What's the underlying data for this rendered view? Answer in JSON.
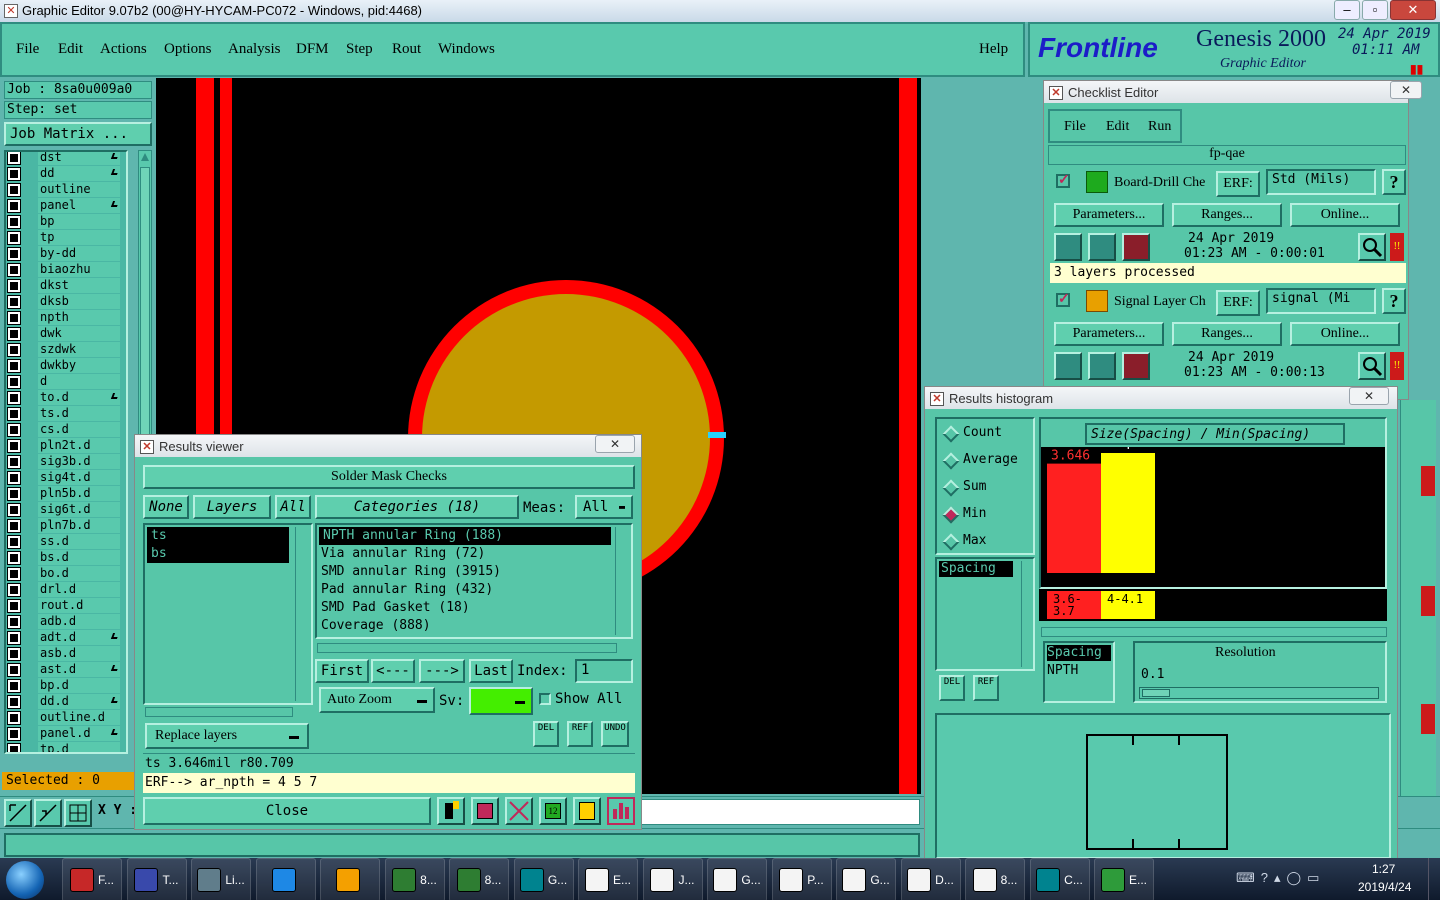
{
  "titlebar": {
    "title": "Graphic Editor 9.07b2 (00@HY-HYCAM-PC072 - Windows, pid:4468)"
  },
  "menu": [
    "File",
    "Edit",
    "Actions",
    "Options",
    "Analysis",
    "DFM",
    "Step",
    "Rout",
    "Windows"
  ],
  "help": "Help",
  "brand": {
    "logo": "Frontline",
    "product": "Genesis 2000",
    "subtitle": "Graphic Editor",
    "date": "24 Apr 2019",
    "time": "01:11 AM"
  },
  "job": {
    "job_label": "Job : 8sa0u009a0",
    "step_label": "Step: set",
    "matrix_button": "Job Matrix ..."
  },
  "layers": [
    "dst",
    "dd",
    "outline",
    "panel",
    "bp",
    "tp",
    "by-dd",
    "biaozhu",
    "dkst",
    "dksb",
    "npth",
    "dwk",
    "szdwk",
    "dwkby",
    "d",
    "to.d",
    "ts.d",
    "cs.d",
    "pln2t.d",
    "sig3b.d",
    "sig4t.d",
    "pln5b.d",
    "sig6t.d",
    "pln7b.d",
    "ss.d",
    "bs.d",
    "bo.d",
    "drl.d",
    "rout.d",
    "adb.d",
    "adt.d",
    "asb.d",
    "ast.d",
    "bp.d",
    "dd.d",
    "outline.d",
    "panel.d",
    "tp.d"
  ],
  "layers_marked": [
    "dst",
    "dd",
    "panel",
    "to.d",
    "adt.d",
    "ast.d",
    "dd.d",
    "panel.d"
  ],
  "selected": "Selected : 0",
  "coord_label": "X Y :",
  "results_viewer": {
    "title": "Results viewer",
    "header": "Solder Mask Checks",
    "none_btn": "None",
    "layers_btn": "Layers",
    "all_btn": "All",
    "categories_btn": "Categories (18)",
    "meas_label": "Meas:",
    "meas_value": "All",
    "layer_list": [
      "ts",
      "bs"
    ],
    "categories": [
      "NPTH annular Ring (188)",
      "Via annular Ring (72)",
      "SMD annular Ring (3915)",
      "Pad annular Ring (432)",
      "SMD Pad Gasket (18)",
      "Coverage (888)"
    ],
    "first": "First",
    "prev": "<---",
    "next": "--->",
    "last": "Last",
    "index_label": "Index:",
    "index_value": "1",
    "auto_zoom": "Auto Zoom",
    "sv_label": "Sv:",
    "show_all": "Show All",
    "replace_layers": "Replace layers",
    "del": "DEL",
    "ref": "REF",
    "undo": "UNDO",
    "status1": "ts 3.646mil  r80.709",
    "status2": "ERF--> ar_npth = 4 5 7",
    "close": "Close"
  },
  "checklist": {
    "title": "Checklist Editor",
    "menu": [
      "File",
      "Edit",
      "Run"
    ],
    "name": "fp-qae",
    "items": [
      {
        "name": "Board-Drill Che",
        "erf_label": "ERF:",
        "erf_value": "Std (Mils)",
        "help": "?",
        "params": "Parameters...",
        "ranges": "Ranges...",
        "online": "Online...",
        "date": "24 Apr 2019",
        "time": "01:23 AM - 0:00:01",
        "status": "3 layers processed"
      },
      {
        "name": "Signal Layer Ch",
        "erf_label": "ERF:",
        "erf_value": "signal (Mi",
        "help": "?",
        "params": "Parameters...",
        "ranges": "Ranges...",
        "online": "Online...",
        "date": "24 Apr 2019",
        "time": "01:23 AM - 0:00:13"
      }
    ]
  },
  "histogram": {
    "title": "Results histogram",
    "options": [
      "Count",
      "Average",
      "Sum",
      "Min",
      "Max"
    ],
    "selected": "Min",
    "chart_title": "Size(Spacing) / Min(Spacing)",
    "list": [
      "Spacing"
    ],
    "resolution_label": "Resolution",
    "resolution_value": "0.1",
    "legend_box": [
      "Spacing",
      "NPTH"
    ],
    "del": "DEL",
    "ref": "REF"
  },
  "chart_data": {
    "type": "bar",
    "title": "Size(Spacing) / Min(Spacing)",
    "categories": [
      "3.6-3.7",
      "4-4.1"
    ],
    "values": [
      3.646,
      4
    ],
    "value_labels": [
      "3.646",
      "4"
    ],
    "colors": [
      "#ff2020",
      "#ffff00"
    ]
  },
  "taskbar": {
    "items": [
      "F...",
      "T...",
      "Li...",
      "",
      "",
      "8...",
      "8...",
      "G...",
      "E...",
      "J...",
      "G...",
      "P...",
      "G...",
      "D...",
      "8...",
      "C...",
      "E..."
    ],
    "time": "1:27",
    "date": "2019/4/24"
  },
  "colors": {
    "teal": "#57c6a8",
    "board": "#000000",
    "red": "#ff0000",
    "pad": "#c49a00"
  }
}
